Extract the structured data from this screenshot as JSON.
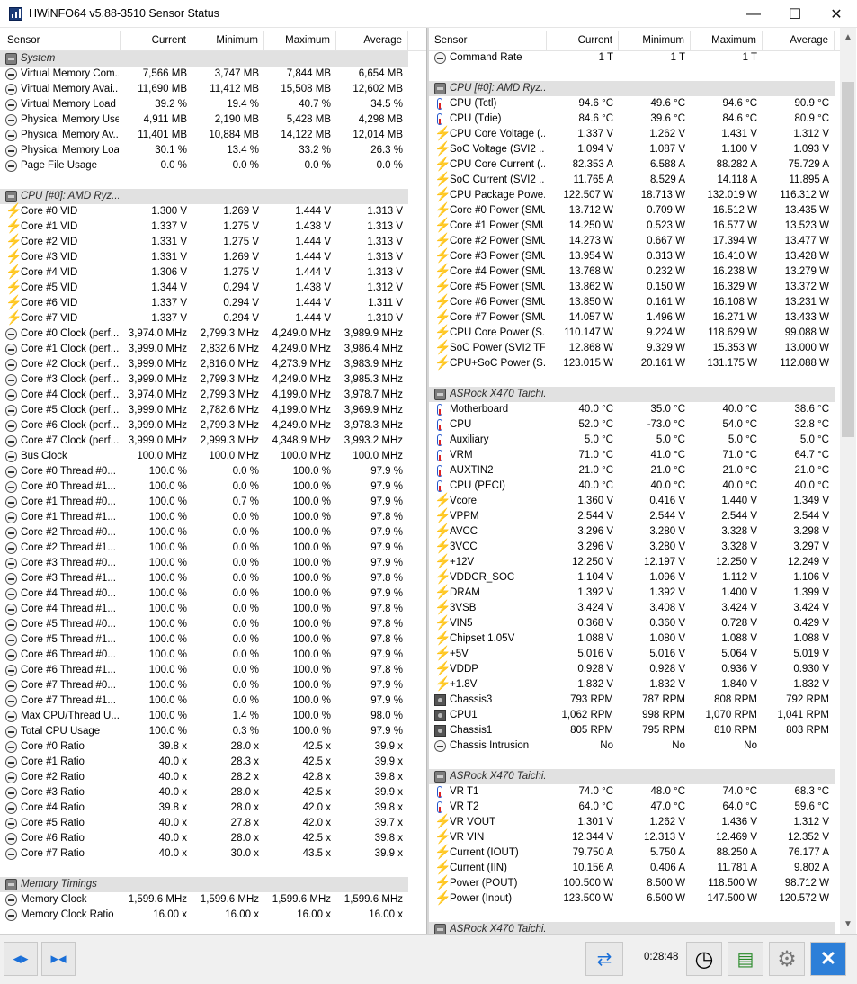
{
  "window": {
    "title": "HWiNFO64 v5.88-3510 Sensor Status",
    "minimize": "—",
    "maximize": "☐",
    "close": "✕"
  },
  "columns": {
    "sensor": "Sensor",
    "current": "Current",
    "minimum": "Minimum",
    "maximum": "Maximum",
    "average": "Average"
  },
  "left_rows": [
    {
      "t": "group",
      "name": "System"
    },
    {
      "t": "row",
      "i": "gauge",
      "name": "Virtual Memory Com...",
      "v": [
        "7,566 MB",
        "3,747 MB",
        "7,844 MB",
        "6,654 MB"
      ]
    },
    {
      "t": "row",
      "i": "gauge",
      "name": "Virtual Memory Avai...",
      "v": [
        "11,690 MB",
        "11,412 MB",
        "15,508 MB",
        "12,602 MB"
      ]
    },
    {
      "t": "row",
      "i": "gauge",
      "name": "Virtual Memory Load",
      "v": [
        "39.2 %",
        "19.4 %",
        "40.7 %",
        "34.5 %"
      ]
    },
    {
      "t": "row",
      "i": "gauge",
      "name": "Physical Memory Used",
      "v": [
        "4,911 MB",
        "2,190 MB",
        "5,428 MB",
        "4,298 MB"
      ]
    },
    {
      "t": "row",
      "i": "gauge",
      "name": "Physical Memory Av...",
      "v": [
        "11,401 MB",
        "10,884 MB",
        "14,122 MB",
        "12,014 MB"
      ]
    },
    {
      "t": "row",
      "i": "gauge",
      "name": "Physical Memory Load",
      "v": [
        "30.1 %",
        "13.4 %",
        "33.2 %",
        "26.3 %"
      ]
    },
    {
      "t": "row",
      "i": "gauge",
      "name": "Page File Usage",
      "v": [
        "0.0 %",
        "0.0 %",
        "0.0 %",
        "0.0 %"
      ]
    },
    {
      "t": "blank"
    },
    {
      "t": "group",
      "name": "CPU [#0]: AMD Ryz..."
    },
    {
      "t": "row",
      "i": "volt",
      "name": "Core #0 VID",
      "v": [
        "1.300 V",
        "1.269 V",
        "1.444 V",
        "1.313 V"
      ]
    },
    {
      "t": "row",
      "i": "volt",
      "name": "Core #1 VID",
      "v": [
        "1.337 V",
        "1.275 V",
        "1.438 V",
        "1.313 V"
      ]
    },
    {
      "t": "row",
      "i": "volt",
      "name": "Core #2 VID",
      "v": [
        "1.331 V",
        "1.275 V",
        "1.444 V",
        "1.313 V"
      ]
    },
    {
      "t": "row",
      "i": "volt",
      "name": "Core #3 VID",
      "v": [
        "1.331 V",
        "1.269 V",
        "1.444 V",
        "1.313 V"
      ]
    },
    {
      "t": "row",
      "i": "volt",
      "name": "Core #4 VID",
      "v": [
        "1.306 V",
        "1.275 V",
        "1.444 V",
        "1.313 V"
      ]
    },
    {
      "t": "row",
      "i": "volt",
      "name": "Core #5 VID",
      "v": [
        "1.344 V",
        "0.294 V",
        "1.438 V",
        "1.312 V"
      ]
    },
    {
      "t": "row",
      "i": "volt",
      "name": "Core #6 VID",
      "v": [
        "1.337 V",
        "0.294 V",
        "1.444 V",
        "1.311 V"
      ]
    },
    {
      "t": "row",
      "i": "volt",
      "name": "Core #7 VID",
      "v": [
        "1.337 V",
        "0.294 V",
        "1.444 V",
        "1.310 V"
      ]
    },
    {
      "t": "row",
      "i": "gauge",
      "name": "Core #0 Clock (perf...",
      "v": [
        "3,974.0 MHz",
        "2,799.3 MHz",
        "4,249.0 MHz",
        "3,989.9 MHz"
      ]
    },
    {
      "t": "row",
      "i": "gauge",
      "name": "Core #1 Clock (perf...",
      "v": [
        "3,999.0 MHz",
        "2,832.6 MHz",
        "4,249.0 MHz",
        "3,986.4 MHz"
      ]
    },
    {
      "t": "row",
      "i": "gauge",
      "name": "Core #2 Clock (perf...",
      "v": [
        "3,999.0 MHz",
        "2,816.0 MHz",
        "4,273.9 MHz",
        "3,983.9 MHz"
      ]
    },
    {
      "t": "row",
      "i": "gauge",
      "name": "Core #3 Clock (perf...",
      "v": [
        "3,999.0 MHz",
        "2,799.3 MHz",
        "4,249.0 MHz",
        "3,985.3 MHz"
      ]
    },
    {
      "t": "row",
      "i": "gauge",
      "name": "Core #4 Clock (perf...",
      "v": [
        "3,974.0 MHz",
        "2,799.3 MHz",
        "4,199.0 MHz",
        "3,978.7 MHz"
      ]
    },
    {
      "t": "row",
      "i": "gauge",
      "name": "Core #5 Clock (perf...",
      "v": [
        "3,999.0 MHz",
        "2,782.6 MHz",
        "4,199.0 MHz",
        "3,969.9 MHz"
      ]
    },
    {
      "t": "row",
      "i": "gauge",
      "name": "Core #6 Clock (perf...",
      "v": [
        "3,999.0 MHz",
        "2,799.3 MHz",
        "4,249.0 MHz",
        "3,978.3 MHz"
      ]
    },
    {
      "t": "row",
      "i": "gauge",
      "name": "Core #7 Clock (perf...",
      "v": [
        "3,999.0 MHz",
        "2,999.3 MHz",
        "4,348.9 MHz",
        "3,993.2 MHz"
      ]
    },
    {
      "t": "row",
      "i": "gauge",
      "name": "Bus Clock",
      "v": [
        "100.0 MHz",
        "100.0 MHz",
        "100.0 MHz",
        "100.0 MHz"
      ]
    },
    {
      "t": "row",
      "i": "gauge",
      "name": "Core #0 Thread #0...",
      "v": [
        "100.0 %",
        "0.0 %",
        "100.0 %",
        "97.9 %"
      ]
    },
    {
      "t": "row",
      "i": "gauge",
      "name": "Core #0 Thread #1...",
      "v": [
        "100.0 %",
        "0.0 %",
        "100.0 %",
        "97.9 %"
      ]
    },
    {
      "t": "row",
      "i": "gauge",
      "name": "Core #1 Thread #0...",
      "v": [
        "100.0 %",
        "0.7 %",
        "100.0 %",
        "97.9 %"
      ]
    },
    {
      "t": "row",
      "i": "gauge",
      "name": "Core #1 Thread #1...",
      "v": [
        "100.0 %",
        "0.0 %",
        "100.0 %",
        "97.8 %"
      ]
    },
    {
      "t": "row",
      "i": "gauge",
      "name": "Core #2 Thread #0...",
      "v": [
        "100.0 %",
        "0.0 %",
        "100.0 %",
        "97.9 %"
      ]
    },
    {
      "t": "row",
      "i": "gauge",
      "name": "Core #2 Thread #1...",
      "v": [
        "100.0 %",
        "0.0 %",
        "100.0 %",
        "97.9 %"
      ]
    },
    {
      "t": "row",
      "i": "gauge",
      "name": "Core #3 Thread #0...",
      "v": [
        "100.0 %",
        "0.0 %",
        "100.0 %",
        "97.9 %"
      ]
    },
    {
      "t": "row",
      "i": "gauge",
      "name": "Core #3 Thread #1...",
      "v": [
        "100.0 %",
        "0.0 %",
        "100.0 %",
        "97.8 %"
      ]
    },
    {
      "t": "row",
      "i": "gauge",
      "name": "Core #4 Thread #0...",
      "v": [
        "100.0 %",
        "0.0 %",
        "100.0 %",
        "97.9 %"
      ]
    },
    {
      "t": "row",
      "i": "gauge",
      "name": "Core #4 Thread #1...",
      "v": [
        "100.0 %",
        "0.0 %",
        "100.0 %",
        "97.8 %"
      ]
    },
    {
      "t": "row",
      "i": "gauge",
      "name": "Core #5 Thread #0...",
      "v": [
        "100.0 %",
        "0.0 %",
        "100.0 %",
        "97.8 %"
      ]
    },
    {
      "t": "row",
      "i": "gauge",
      "name": "Core #5 Thread #1...",
      "v": [
        "100.0 %",
        "0.0 %",
        "100.0 %",
        "97.8 %"
      ]
    },
    {
      "t": "row",
      "i": "gauge",
      "name": "Core #6 Thread #0...",
      "v": [
        "100.0 %",
        "0.0 %",
        "100.0 %",
        "97.9 %"
      ]
    },
    {
      "t": "row",
      "i": "gauge",
      "name": "Core #6 Thread #1...",
      "v": [
        "100.0 %",
        "0.0 %",
        "100.0 %",
        "97.8 %"
      ]
    },
    {
      "t": "row",
      "i": "gauge",
      "name": "Core #7 Thread #0...",
      "v": [
        "100.0 %",
        "0.0 %",
        "100.0 %",
        "97.9 %"
      ]
    },
    {
      "t": "row",
      "i": "gauge",
      "name": "Core #7 Thread #1...",
      "v": [
        "100.0 %",
        "0.0 %",
        "100.0 %",
        "97.9 %"
      ]
    },
    {
      "t": "row",
      "i": "gauge",
      "name": "Max CPU/Thread U...",
      "v": [
        "100.0 %",
        "1.4 %",
        "100.0 %",
        "98.0 %"
      ]
    },
    {
      "t": "row",
      "i": "gauge",
      "name": "Total CPU Usage",
      "v": [
        "100.0 %",
        "0.3 %",
        "100.0 %",
        "97.9 %"
      ]
    },
    {
      "t": "row",
      "i": "gauge",
      "name": "Core #0 Ratio",
      "v": [
        "39.8 x",
        "28.0 x",
        "42.5 x",
        "39.9 x"
      ]
    },
    {
      "t": "row",
      "i": "gauge",
      "name": "Core #1 Ratio",
      "v": [
        "40.0 x",
        "28.3 x",
        "42.5 x",
        "39.9 x"
      ]
    },
    {
      "t": "row",
      "i": "gauge",
      "name": "Core #2 Ratio",
      "v": [
        "40.0 x",
        "28.2 x",
        "42.8 x",
        "39.8 x"
      ]
    },
    {
      "t": "row",
      "i": "gauge",
      "name": "Core #3 Ratio",
      "v": [
        "40.0 x",
        "28.0 x",
        "42.5 x",
        "39.9 x"
      ]
    },
    {
      "t": "row",
      "i": "gauge",
      "name": "Core #4 Ratio",
      "v": [
        "39.8 x",
        "28.0 x",
        "42.0 x",
        "39.8 x"
      ]
    },
    {
      "t": "row",
      "i": "gauge",
      "name": "Core #5 Ratio",
      "v": [
        "40.0 x",
        "27.8 x",
        "42.0 x",
        "39.7 x"
      ]
    },
    {
      "t": "row",
      "i": "gauge",
      "name": "Core #6 Ratio",
      "v": [
        "40.0 x",
        "28.0 x",
        "42.5 x",
        "39.8 x"
      ]
    },
    {
      "t": "row",
      "i": "gauge",
      "name": "Core #7 Ratio",
      "v": [
        "40.0 x",
        "30.0 x",
        "43.5 x",
        "39.9 x"
      ]
    },
    {
      "t": "blank"
    },
    {
      "t": "group",
      "name": "Memory Timings"
    },
    {
      "t": "row",
      "i": "gauge",
      "name": "Memory Clock",
      "v": [
        "1,599.6 MHz",
        "1,599.6 MHz",
        "1,599.6 MHz",
        "1,599.6 MHz"
      ]
    },
    {
      "t": "row",
      "i": "gauge",
      "name": "Memory Clock Ratio",
      "v": [
        "16.00 x",
        "16.00 x",
        "16.00 x",
        "16.00 x"
      ]
    }
  ],
  "right_rows": [
    {
      "t": "row",
      "i": "gauge",
      "name": "Command Rate",
      "v": [
        "1 T",
        "1 T",
        "1 T",
        ""
      ]
    },
    {
      "t": "blank"
    },
    {
      "t": "group",
      "name": "CPU [#0]: AMD Ryz..."
    },
    {
      "t": "row",
      "i": "therm",
      "name": "CPU (Tctl)",
      "v": [
        "94.6 °C",
        "49.6 °C",
        "94.6 °C",
        "90.9 °C"
      ]
    },
    {
      "t": "row",
      "i": "therm",
      "name": "CPU (Tdie)",
      "v": [
        "84.6 °C",
        "39.6 °C",
        "84.6 °C",
        "80.9 °C"
      ]
    },
    {
      "t": "row",
      "i": "volt",
      "name": "CPU Core Voltage (...",
      "v": [
        "1.337 V",
        "1.262 V",
        "1.431 V",
        "1.312 V"
      ]
    },
    {
      "t": "row",
      "i": "volt",
      "name": "SoC Voltage (SVI2 ...",
      "v": [
        "1.094 V",
        "1.087 V",
        "1.100 V",
        "1.093 V"
      ]
    },
    {
      "t": "row",
      "i": "volt",
      "name": "CPU Core Current (...",
      "v": [
        "82.353 A",
        "6.588 A",
        "88.282 A",
        "75.729 A"
      ]
    },
    {
      "t": "row",
      "i": "volt",
      "name": "SoC Current (SVI2 ...",
      "v": [
        "11.765 A",
        "8.529 A",
        "14.118 A",
        "11.895 A"
      ]
    },
    {
      "t": "row",
      "i": "volt",
      "name": "CPU Package Powe...",
      "v": [
        "122.507 W",
        "18.713 W",
        "132.019 W",
        "116.312 W"
      ]
    },
    {
      "t": "row",
      "i": "volt",
      "name": "Core #0 Power (SMU)",
      "v": [
        "13.712 W",
        "0.709 W",
        "16.512 W",
        "13.435 W"
      ]
    },
    {
      "t": "row",
      "i": "volt",
      "name": "Core #1 Power (SMU)",
      "v": [
        "14.250 W",
        "0.523 W",
        "16.577 W",
        "13.523 W"
      ]
    },
    {
      "t": "row",
      "i": "volt",
      "name": "Core #2 Power (SMU)",
      "v": [
        "14.273 W",
        "0.667 W",
        "17.394 W",
        "13.477 W"
      ]
    },
    {
      "t": "row",
      "i": "volt",
      "name": "Core #3 Power (SMU)",
      "v": [
        "13.954 W",
        "0.313 W",
        "16.410 W",
        "13.428 W"
      ]
    },
    {
      "t": "row",
      "i": "volt",
      "name": "Core #4 Power (SMU)",
      "v": [
        "13.768 W",
        "0.232 W",
        "16.238 W",
        "13.279 W"
      ]
    },
    {
      "t": "row",
      "i": "volt",
      "name": "Core #5 Power (SMU)",
      "v": [
        "13.862 W",
        "0.150 W",
        "16.329 W",
        "13.372 W"
      ]
    },
    {
      "t": "row",
      "i": "volt",
      "name": "Core #6 Power (SMU)",
      "v": [
        "13.850 W",
        "0.161 W",
        "16.108 W",
        "13.231 W"
      ]
    },
    {
      "t": "row",
      "i": "volt",
      "name": "Core #7 Power (SMU)",
      "v": [
        "14.057 W",
        "1.496 W",
        "16.271 W",
        "13.433 W"
      ]
    },
    {
      "t": "row",
      "i": "volt",
      "name": "CPU Core Power (S...",
      "v": [
        "110.147 W",
        "9.224 W",
        "118.629 W",
        "99.088 W"
      ]
    },
    {
      "t": "row",
      "i": "volt",
      "name": "SoC Power (SVI2 TFN)",
      "v": [
        "12.868 W",
        "9.329 W",
        "15.353 W",
        "13.000 W"
      ]
    },
    {
      "t": "row",
      "i": "volt",
      "name": "CPU+SoC Power (S...",
      "v": [
        "123.015 W",
        "20.161 W",
        "131.175 W",
        "112.088 W"
      ]
    },
    {
      "t": "blank"
    },
    {
      "t": "group",
      "name": "ASRock X470 Taichi..."
    },
    {
      "t": "row",
      "i": "therm",
      "name": "Motherboard",
      "v": [
        "40.0 °C",
        "35.0 °C",
        "40.0 °C",
        "38.6 °C"
      ]
    },
    {
      "t": "row",
      "i": "therm",
      "name": "CPU",
      "v": [
        "52.0 °C",
        "-73.0 °C",
        "54.0 °C",
        "32.8 °C"
      ]
    },
    {
      "t": "row",
      "i": "therm",
      "name": "Auxiliary",
      "v": [
        "5.0 °C",
        "5.0 °C",
        "5.0 °C",
        "5.0 °C"
      ]
    },
    {
      "t": "row",
      "i": "therm",
      "name": "VRM",
      "v": [
        "71.0 °C",
        "41.0 °C",
        "71.0 °C",
        "64.7 °C"
      ]
    },
    {
      "t": "row",
      "i": "therm",
      "name": "AUXTIN2",
      "v": [
        "21.0 °C",
        "21.0 °C",
        "21.0 °C",
        "21.0 °C"
      ]
    },
    {
      "t": "row",
      "i": "therm",
      "name": "CPU (PECI)",
      "v": [
        "40.0 °C",
        "40.0 °C",
        "40.0 °C",
        "40.0 °C"
      ]
    },
    {
      "t": "row",
      "i": "volt",
      "name": "Vcore",
      "v": [
        "1.360 V",
        "0.416 V",
        "1.440 V",
        "1.349 V"
      ]
    },
    {
      "t": "row",
      "i": "volt",
      "name": "VPPM",
      "v": [
        "2.544 V",
        "2.544 V",
        "2.544 V",
        "2.544 V"
      ]
    },
    {
      "t": "row",
      "i": "volt",
      "name": "AVCC",
      "v": [
        "3.296 V",
        "3.280 V",
        "3.328 V",
        "3.298 V"
      ]
    },
    {
      "t": "row",
      "i": "volt",
      "name": "3VCC",
      "v": [
        "3.296 V",
        "3.280 V",
        "3.328 V",
        "3.297 V"
      ]
    },
    {
      "t": "row",
      "i": "volt",
      "name": "+12V",
      "v": [
        "12.250 V",
        "12.197 V",
        "12.250 V",
        "12.249 V"
      ]
    },
    {
      "t": "row",
      "i": "volt",
      "name": "VDDCR_SOC",
      "v": [
        "1.104 V",
        "1.096 V",
        "1.112 V",
        "1.106 V"
      ]
    },
    {
      "t": "row",
      "i": "volt",
      "name": "DRAM",
      "v": [
        "1.392 V",
        "1.392 V",
        "1.400 V",
        "1.399 V"
      ]
    },
    {
      "t": "row",
      "i": "volt",
      "name": "3VSB",
      "v": [
        "3.424 V",
        "3.408 V",
        "3.424 V",
        "3.424 V"
      ]
    },
    {
      "t": "row",
      "i": "volt",
      "name": "VIN5",
      "v": [
        "0.368 V",
        "0.360 V",
        "0.728 V",
        "0.429 V"
      ]
    },
    {
      "t": "row",
      "i": "volt",
      "name": "Chipset 1.05V",
      "v": [
        "1.088 V",
        "1.080 V",
        "1.088 V",
        "1.088 V"
      ]
    },
    {
      "t": "row",
      "i": "volt",
      "name": "+5V",
      "v": [
        "5.016 V",
        "5.016 V",
        "5.064 V",
        "5.019 V"
      ]
    },
    {
      "t": "row",
      "i": "volt",
      "name": "VDDP",
      "v": [
        "0.928 V",
        "0.928 V",
        "0.936 V",
        "0.930 V"
      ]
    },
    {
      "t": "row",
      "i": "volt",
      "name": "+1.8V",
      "v": [
        "1.832 V",
        "1.832 V",
        "1.840 V",
        "1.832 V"
      ]
    },
    {
      "t": "row",
      "i": "fan",
      "name": "Chassis3",
      "v": [
        "793 RPM",
        "787 RPM",
        "808 RPM",
        "792 RPM"
      ]
    },
    {
      "t": "row",
      "i": "fan",
      "name": "CPU1",
      "v": [
        "1,062 RPM",
        "998 RPM",
        "1,070 RPM",
        "1,041 RPM"
      ]
    },
    {
      "t": "row",
      "i": "fan",
      "name": "Chassis1",
      "v": [
        "805 RPM",
        "795 RPM",
        "810 RPM",
        "803 RPM"
      ]
    },
    {
      "t": "row",
      "i": "gauge",
      "name": "Chassis Intrusion",
      "v": [
        "No",
        "No",
        "No",
        ""
      ]
    },
    {
      "t": "blank"
    },
    {
      "t": "group",
      "name": "ASRock X470 Taichi..."
    },
    {
      "t": "row",
      "i": "therm",
      "name": "VR T1",
      "v": [
        "74.0 °C",
        "48.0 °C",
        "74.0 °C",
        "68.3 °C"
      ]
    },
    {
      "t": "row",
      "i": "therm",
      "name": "VR T2",
      "v": [
        "64.0 °C",
        "47.0 °C",
        "64.0 °C",
        "59.6 °C"
      ]
    },
    {
      "t": "row",
      "i": "volt",
      "name": "VR VOUT",
      "v": [
        "1.301 V",
        "1.262 V",
        "1.436 V",
        "1.312 V"
      ]
    },
    {
      "t": "row",
      "i": "volt",
      "name": "VR VIN",
      "v": [
        "12.344 V",
        "12.313 V",
        "12.469 V",
        "12.352 V"
      ]
    },
    {
      "t": "row",
      "i": "volt",
      "name": "Current (IOUT)",
      "v": [
        "79.750 A",
        "5.750 A",
        "88.250 A",
        "76.177 A"
      ]
    },
    {
      "t": "row",
      "i": "volt",
      "name": "Current (IIN)",
      "v": [
        "10.156 A",
        "0.406 A",
        "11.781 A",
        "9.802 A"
      ]
    },
    {
      "t": "row",
      "i": "volt",
      "name": "Power (POUT)",
      "v": [
        "100.500 W",
        "8.500 W",
        "118.500 W",
        "98.712 W"
      ]
    },
    {
      "t": "row",
      "i": "volt",
      "name": "Power (Input)",
      "v": [
        "123.500 W",
        "6.500 W",
        "147.500 W",
        "120.572 W"
      ]
    },
    {
      "t": "blank"
    },
    {
      "t": "group",
      "name": "ASRock X470 Taichi..."
    }
  ],
  "toolbar": {
    "nav_left": "◂▸",
    "nav_right": "▸◂",
    "network": "⇄",
    "elapsed": "0:28:48",
    "clock": "◷",
    "report": "▤",
    "settings": "⚙",
    "close": "✕"
  },
  "scrollbar": {
    "up": "▲",
    "down": "▼"
  }
}
